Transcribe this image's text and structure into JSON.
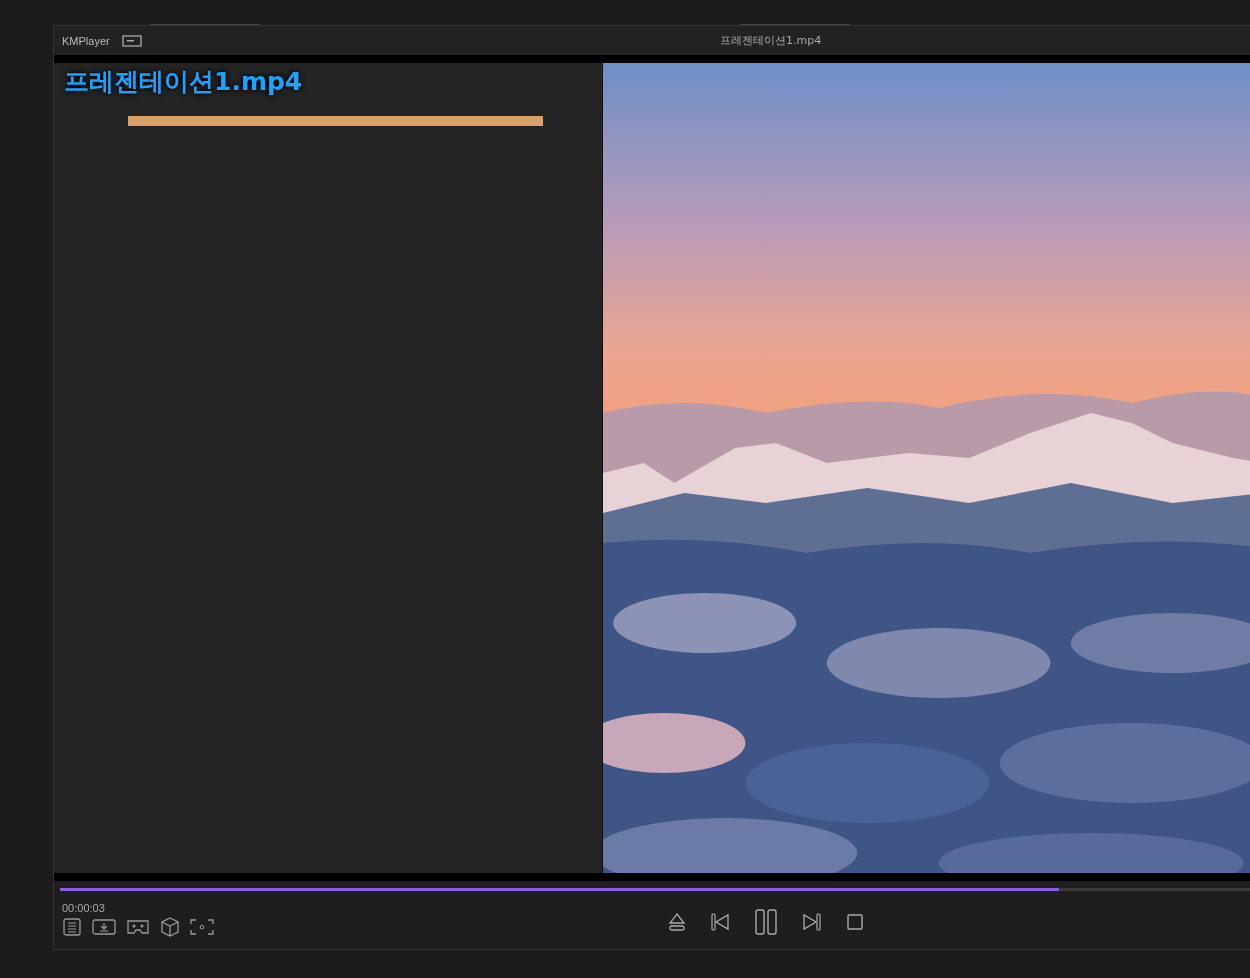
{
  "window": {
    "app_name": "KMPlayer",
    "title": "프레젠테이션1.mp4"
  },
  "slide": {
    "title": "프레젠테이션1.mp4"
  },
  "seek_bar": {
    "level": 0.83
  },
  "time": "00:00:03"
}
